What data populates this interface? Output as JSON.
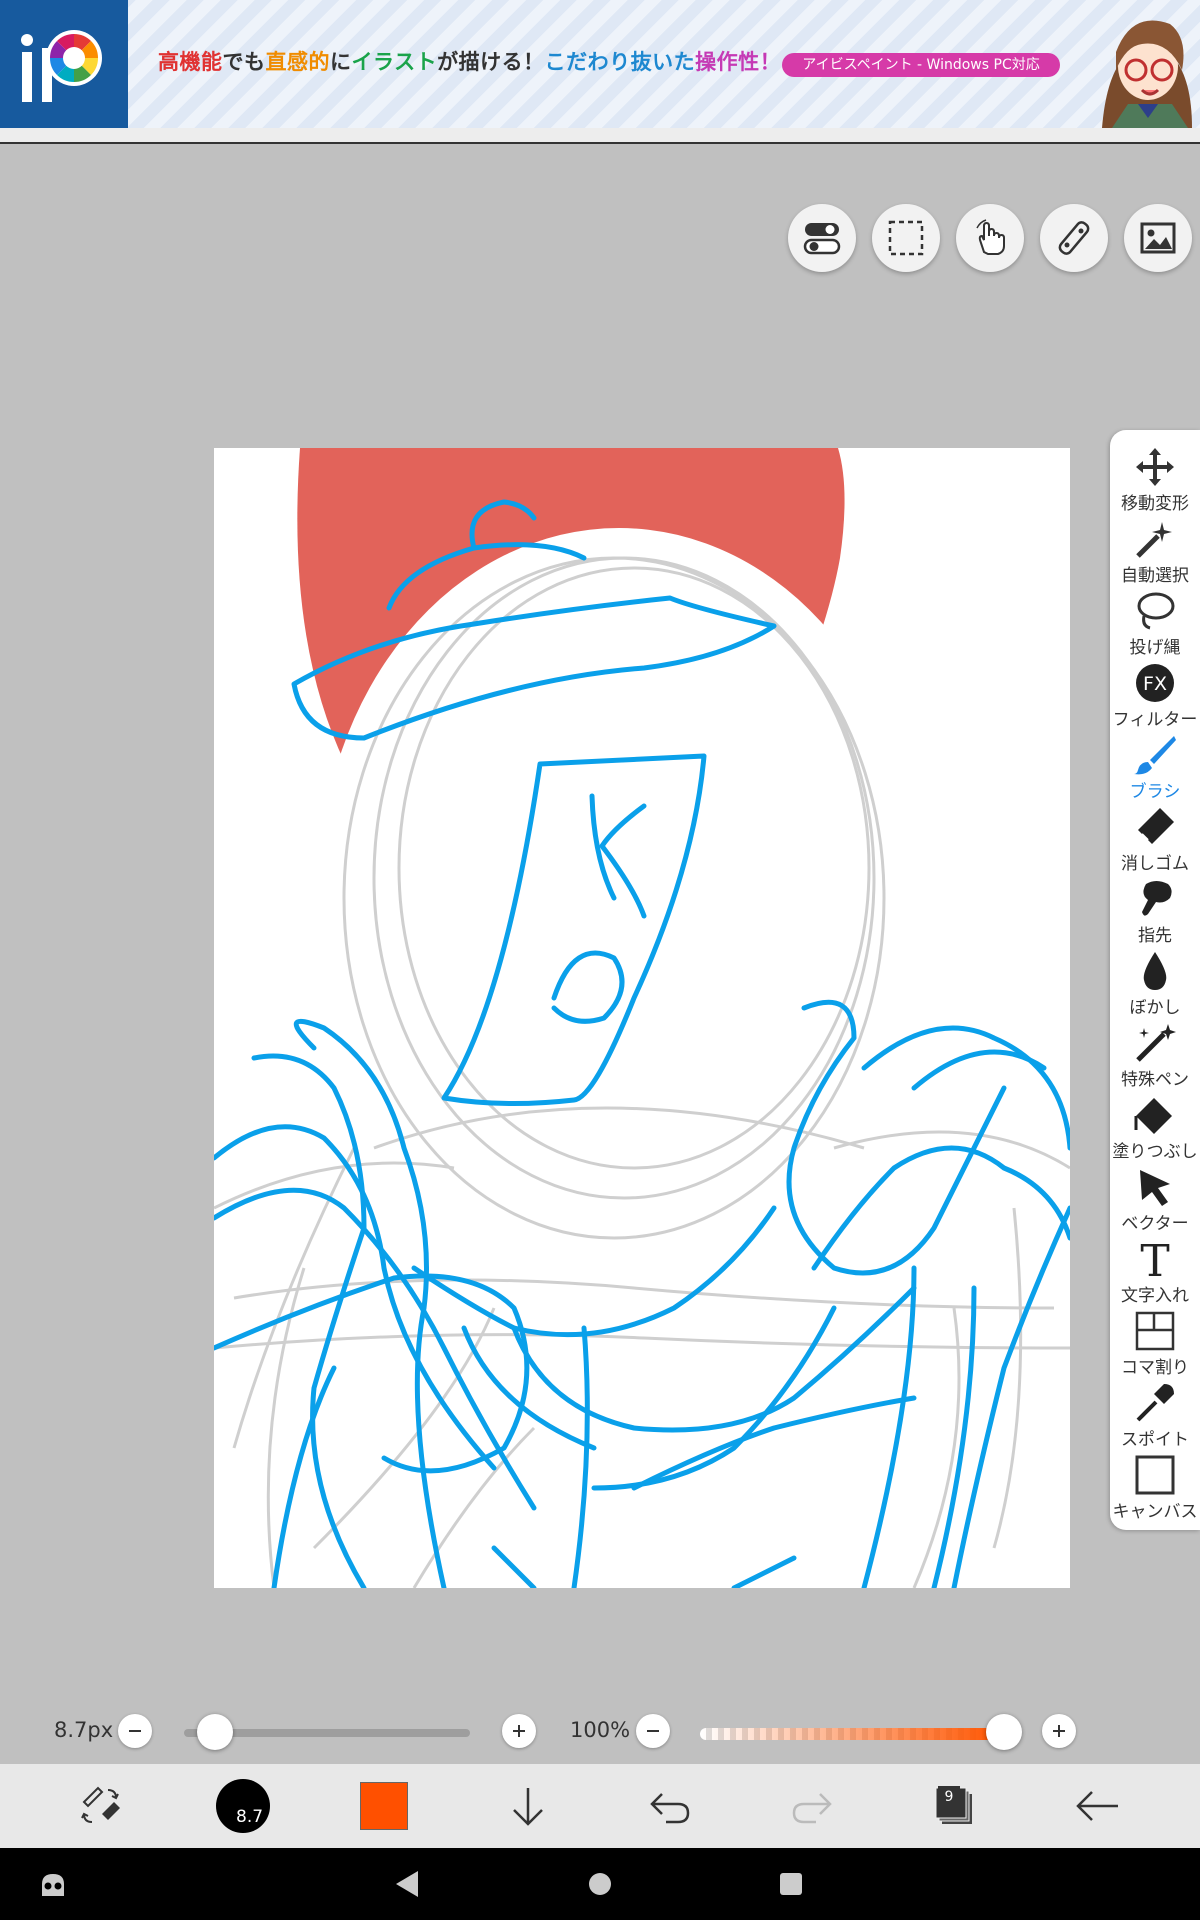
{
  "banner": {
    "logo_text": "ip",
    "text_parts": [
      "高機能",
      "でも",
      "直感的",
      "に",
      "イラスト",
      "が描ける！",
      "こだわり抜いた",
      "操作性！"
    ],
    "pill": "アイビスペイント - Windows PC対応"
  },
  "top_tools": [
    {
      "name": "toggle-icon"
    },
    {
      "name": "selection-icon"
    },
    {
      "name": "hand-icon"
    },
    {
      "name": "ruler-icon"
    },
    {
      "name": "image-icon"
    }
  ],
  "tools": [
    {
      "label": "移動変形",
      "icon": "move-icon"
    },
    {
      "label": "自動選択",
      "icon": "magic-wand-icon"
    },
    {
      "label": "投げ縄",
      "icon": "lasso-icon"
    },
    {
      "label": "フィルター",
      "icon": "fx-icon",
      "glyph": "FX"
    },
    {
      "label": "ブラシ",
      "icon": "brush-icon",
      "active": true
    },
    {
      "label": "消しゴム",
      "icon": "eraser-icon"
    },
    {
      "label": "指先",
      "icon": "finger-icon"
    },
    {
      "label": "ぼかし",
      "icon": "blur-icon"
    },
    {
      "label": "特殊ペン",
      "icon": "special-pen-icon"
    },
    {
      "label": "塗りつぶし",
      "icon": "fill-icon"
    },
    {
      "label": "ベクター",
      "icon": "vector-icon"
    },
    {
      "label": "文字入れ",
      "icon": "text-icon",
      "glyph": "T"
    },
    {
      "label": "コマ割り",
      "icon": "frame-divider-icon"
    },
    {
      "label": "スポイト",
      "icon": "eyedropper-icon"
    },
    {
      "label": "キャンバス",
      "icon": "canvas-icon"
    }
  ],
  "brush": {
    "size_label": "8.7px",
    "size_value": 8.7,
    "size_fraction": 0.05,
    "opacity_label": "100%",
    "opacity_fraction": 1.0
  },
  "toolbar": {
    "brush_size_text": "8.7",
    "color": "#ff5000",
    "layer_count": "9"
  },
  "colors": {
    "accent": "#1e88e5",
    "stroke_blue": "#0aa0ea",
    "sun_red": "#e2635a"
  }
}
